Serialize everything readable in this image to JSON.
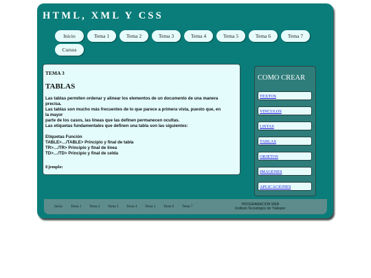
{
  "site": {
    "title": "HTML, XML Y CSS"
  },
  "nav": {
    "items": [
      {
        "label": "Inicio"
      },
      {
        "label": "Tema 1"
      },
      {
        "label": "Tema 2"
      },
      {
        "label": "Tema 3"
      },
      {
        "label": "Tema 4"
      },
      {
        "label": "Tema 5"
      },
      {
        "label": "Tema 6"
      },
      {
        "label": "Tema 7"
      },
      {
        "label": "Cursos"
      }
    ]
  },
  "content": {
    "topic": "TEMA 3",
    "heading": "TABLAS",
    "paragraph_lines": [
      "Las tablas permiten ordenar y alinear los elementos de un documento de una manera",
      "precisa.",
      "Las tablas son mucho más frecuentes de lo que parece a primera vista, puesto que, en",
      "la mayor",
      "parte de los casos, las líneas que las definen permanecen ocultas.",
      "Las etiquetas fundamentales que definen una tabla son las siguientes:"
    ],
    "tags_header": "Etiquetas Función",
    "tags": [
      "TABLE>…/TABLE> Principio y final de tabla",
      "TR>…/TR> Principio y final de línea",
      "TD>…/TD> Principio y final de celda"
    ],
    "example_label": "Ejemplo:"
  },
  "sidebar": {
    "title": "COMO CREAR",
    "links": [
      {
        "label": "TEXTOS"
      },
      {
        "label": "VINCULOS"
      },
      {
        "label": "LISTAS"
      },
      {
        "label": "TABLAS"
      },
      {
        "label": "OBJETOS"
      },
      {
        "label": "IMAGENES"
      },
      {
        "label": "APLICACIONES"
      }
    ]
  },
  "footer": {
    "links": [
      {
        "label": "Inicio"
      },
      {
        "label": "Tema 1"
      },
      {
        "label": "Tema 2"
      },
      {
        "label": "Tema 3"
      },
      {
        "label": "Tema 4"
      },
      {
        "label": "Tema 5"
      },
      {
        "label": "Tema 6"
      },
      {
        "label": "Tema 7"
      }
    ],
    "credit_line1": "PROGRAMACION WEB",
    "credit_line2": "Instituto Tecnológico de Tlaltepec"
  },
  "colors": {
    "frame": "#0a7d7a",
    "panel": "#e4fcfc",
    "sidebar": "#2e7d7a",
    "footer": "#5e8c8c",
    "link": "#1a1adb"
  }
}
